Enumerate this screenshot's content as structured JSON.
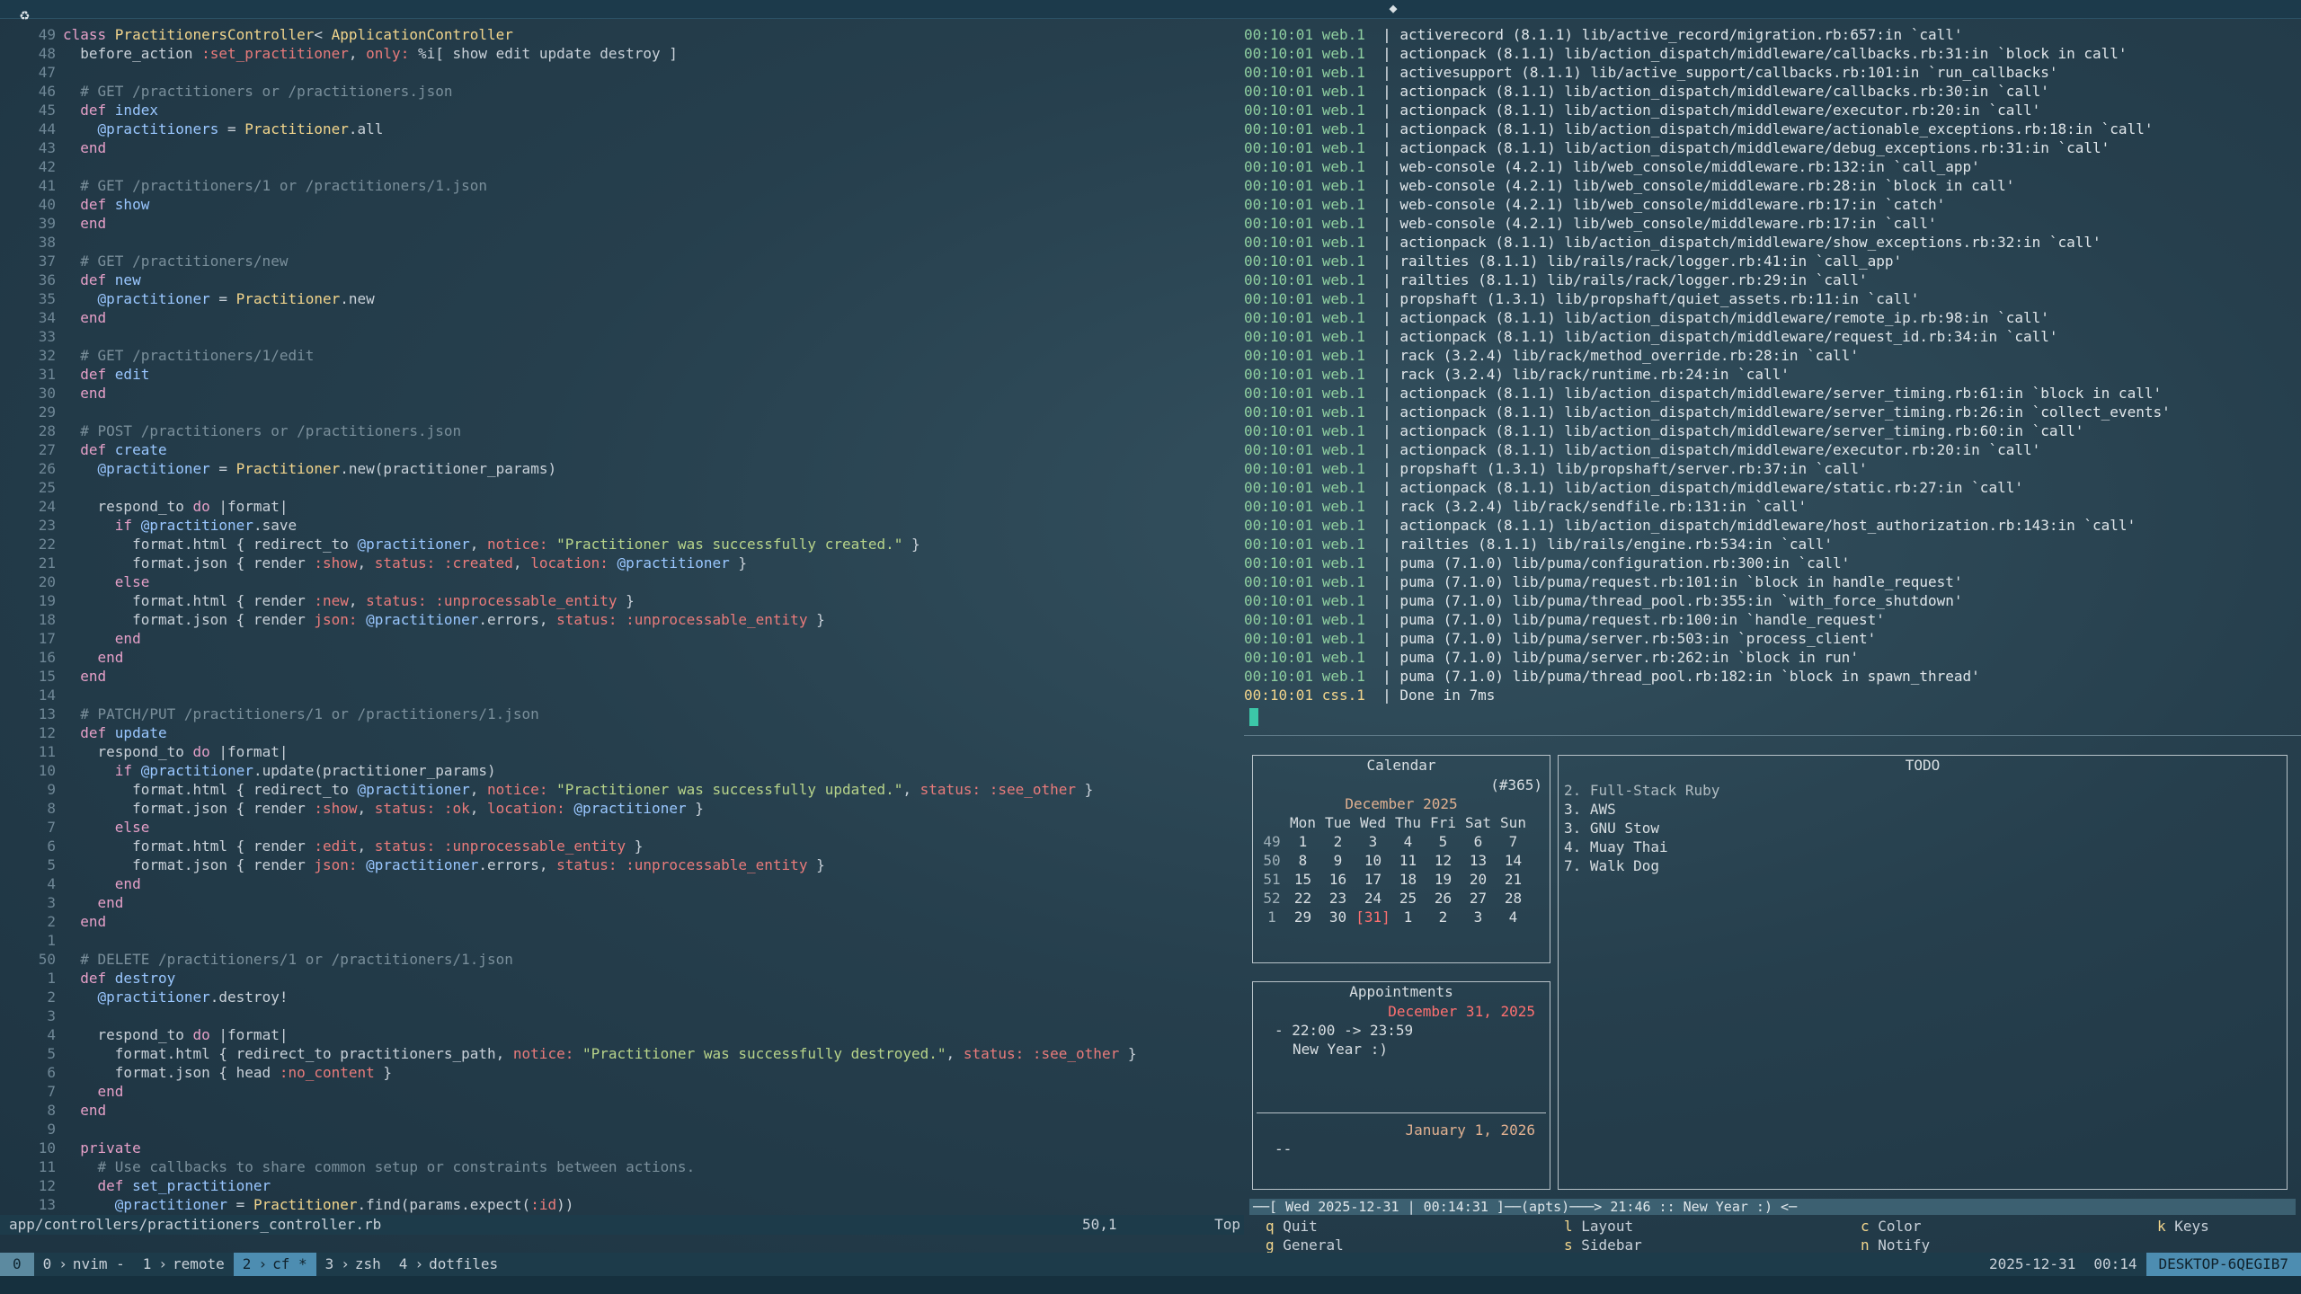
{
  "editor": {
    "status_file": "app/controllers/practitioners_controller.rb",
    "status_pos": "50,1",
    "status_scroll": "Top",
    "lines": [
      {
        "n": "49",
        "t": [
          [
            "kw",
            "class "
          ],
          [
            "cls",
            "PractitionersController"
          ],
          [
            "",
            "< "
          ],
          [
            "cls",
            "ApplicationController"
          ]
        ]
      },
      {
        "n": "48",
        "t": [
          [
            "",
            "  before_action "
          ],
          [
            "sym",
            ":set_practitioner"
          ],
          [
            "",
            ", "
          ],
          [
            "sym",
            "only: "
          ],
          [
            "",
            "%i[ show edit update destroy ]"
          ]
        ]
      },
      {
        "n": "47",
        "t": []
      },
      {
        "n": "46",
        "t": [
          [
            "cm",
            "  # GET /practitioners or /practitioners.json"
          ]
        ]
      },
      {
        "n": "45",
        "t": [
          [
            "kw",
            "  def "
          ],
          [
            "fn",
            "index"
          ]
        ]
      },
      {
        "n": "44",
        "t": [
          [
            "ivar",
            "    @practitioners"
          ],
          [
            "",
            " = "
          ],
          [
            "cls",
            "Practitioner"
          ],
          [
            "",
            ".all"
          ]
        ]
      },
      {
        "n": "43",
        "t": [
          [
            "kw",
            "  end"
          ]
        ]
      },
      {
        "n": "42",
        "t": []
      },
      {
        "n": "41",
        "t": [
          [
            "cm",
            "  # GET /practitioners/1 or /practitioners/1.json"
          ]
        ]
      },
      {
        "n": "40",
        "t": [
          [
            "kw",
            "  def "
          ],
          [
            "fn",
            "show"
          ]
        ]
      },
      {
        "n": "39",
        "t": [
          [
            "kw",
            "  end"
          ]
        ]
      },
      {
        "n": "38",
        "t": []
      },
      {
        "n": "37",
        "t": [
          [
            "cm",
            "  # GET /practitioners/new"
          ]
        ]
      },
      {
        "n": "36",
        "t": [
          [
            "kw",
            "  def "
          ],
          [
            "fn",
            "new"
          ]
        ]
      },
      {
        "n": "35",
        "t": [
          [
            "ivar",
            "    @practitioner"
          ],
          [
            "",
            " = "
          ],
          [
            "cls",
            "Practitioner"
          ],
          [
            "",
            ".new"
          ]
        ]
      },
      {
        "n": "34",
        "t": [
          [
            "kw",
            "  end"
          ]
        ]
      },
      {
        "n": "33",
        "t": []
      },
      {
        "n": "32",
        "t": [
          [
            "cm",
            "  # GET /practitioners/1/edit"
          ]
        ]
      },
      {
        "n": "31",
        "t": [
          [
            "kw",
            "  def "
          ],
          [
            "fn",
            "edit"
          ]
        ]
      },
      {
        "n": "30",
        "t": [
          [
            "kw",
            "  end"
          ]
        ]
      },
      {
        "n": "29",
        "t": []
      },
      {
        "n": "28",
        "t": [
          [
            "cm",
            "  # POST /practitioners or /practitioners.json"
          ]
        ]
      },
      {
        "n": "27",
        "t": [
          [
            "kw",
            "  def "
          ],
          [
            "fn",
            "create"
          ]
        ]
      },
      {
        "n": "26",
        "t": [
          [
            "ivar",
            "    @practitioner"
          ],
          [
            "",
            " = "
          ],
          [
            "cls",
            "Practitioner"
          ],
          [
            "",
            ".new(practitioner_params)"
          ]
        ]
      },
      {
        "n": "25",
        "t": []
      },
      {
        "n": "24",
        "t": [
          [
            "",
            "    respond_to "
          ],
          [
            "kw",
            "do"
          ],
          [
            "",
            " |format|"
          ]
        ]
      },
      {
        "n": "23",
        "t": [
          [
            "kw",
            "      if "
          ],
          [
            "ivar",
            "@practitioner"
          ],
          [
            "",
            ".save"
          ]
        ]
      },
      {
        "n": "22",
        "t": [
          [
            "",
            "        format.html { redirect_to "
          ],
          [
            "ivar",
            "@practitioner"
          ],
          [
            "",
            ", "
          ],
          [
            "sym",
            "notice: "
          ],
          [
            "str",
            "\"Practitioner was successfully created.\""
          ],
          [
            "",
            " }"
          ]
        ]
      },
      {
        "n": "21",
        "t": [
          [
            "",
            "        format.json { render "
          ],
          [
            "sym",
            ":show"
          ],
          [
            "",
            ", "
          ],
          [
            "sym",
            "status: "
          ],
          [
            "sym",
            ":created"
          ],
          [
            "",
            ", "
          ],
          [
            "sym",
            "location: "
          ],
          [
            "ivar",
            "@practitioner"
          ],
          [
            "",
            " }"
          ]
        ]
      },
      {
        "n": "20",
        "t": [
          [
            "kw",
            "      else"
          ]
        ]
      },
      {
        "n": "19",
        "t": [
          [
            "",
            "        format.html { render "
          ],
          [
            "sym",
            ":new"
          ],
          [
            "",
            ", "
          ],
          [
            "sym",
            "status: "
          ],
          [
            "sym",
            ":unprocessable_entity"
          ],
          [
            "",
            " }"
          ]
        ]
      },
      {
        "n": "18",
        "t": [
          [
            "",
            "        format.json { render "
          ],
          [
            "sym",
            "json: "
          ],
          [
            "ivar",
            "@practitioner"
          ],
          [
            "",
            ".errors, "
          ],
          [
            "sym",
            "status: "
          ],
          [
            "sym",
            ":unprocessable_entity"
          ],
          [
            "",
            " }"
          ]
        ]
      },
      {
        "n": "17",
        "t": [
          [
            "kw",
            "      end"
          ]
        ]
      },
      {
        "n": "16",
        "t": [
          [
            "kw",
            "    end"
          ]
        ]
      },
      {
        "n": "15",
        "t": [
          [
            "kw",
            "  end"
          ]
        ]
      },
      {
        "n": "14",
        "t": []
      },
      {
        "n": "13",
        "t": [
          [
            "cm",
            "  # PATCH/PUT /practitioners/1 or /practitioners/1.json"
          ]
        ]
      },
      {
        "n": "12",
        "t": [
          [
            "kw",
            "  def "
          ],
          [
            "fn",
            "update"
          ]
        ]
      },
      {
        "n": "11",
        "t": [
          [
            "",
            "    respond_to "
          ],
          [
            "kw",
            "do"
          ],
          [
            "",
            " |format|"
          ]
        ]
      },
      {
        "n": "10",
        "t": [
          [
            "kw",
            "      if "
          ],
          [
            "ivar",
            "@practitioner"
          ],
          [
            "",
            ".update(practitioner_params)"
          ]
        ]
      },
      {
        "n": "9",
        "t": [
          [
            "",
            "        format.html { redirect_to "
          ],
          [
            "ivar",
            "@practitioner"
          ],
          [
            "",
            ", "
          ],
          [
            "sym",
            "notice: "
          ],
          [
            "str",
            "\"Practitioner was successfully updated.\""
          ],
          [
            "",
            ", "
          ],
          [
            "sym",
            "status: "
          ],
          [
            "sym",
            ":see_other"
          ],
          [
            "",
            " }"
          ]
        ]
      },
      {
        "n": "8",
        "t": [
          [
            "",
            "        format.json { render "
          ],
          [
            "sym",
            ":show"
          ],
          [
            "",
            ", "
          ],
          [
            "sym",
            "status: "
          ],
          [
            "sym",
            ":ok"
          ],
          [
            "",
            ", "
          ],
          [
            "sym",
            "location: "
          ],
          [
            "ivar",
            "@practitioner"
          ],
          [
            "",
            " }"
          ]
        ]
      },
      {
        "n": "7",
        "t": [
          [
            "kw",
            "      else"
          ]
        ]
      },
      {
        "n": "6",
        "t": [
          [
            "",
            "        format.html { render "
          ],
          [
            "sym",
            ":edit"
          ],
          [
            "",
            ", "
          ],
          [
            "sym",
            "status: "
          ],
          [
            "sym",
            ":unprocessable_entity"
          ],
          [
            "",
            " }"
          ]
        ]
      },
      {
        "n": "5",
        "t": [
          [
            "",
            "        format.json { render "
          ],
          [
            "sym",
            "json: "
          ],
          [
            "ivar",
            "@practitioner"
          ],
          [
            "",
            ".errors, "
          ],
          [
            "sym",
            "status: "
          ],
          [
            "sym",
            ":unprocessable_entity"
          ],
          [
            "",
            " }"
          ]
        ]
      },
      {
        "n": "4",
        "t": [
          [
            "kw",
            "      end"
          ]
        ]
      },
      {
        "n": "3",
        "t": [
          [
            "kw",
            "    end"
          ]
        ]
      },
      {
        "n": "2",
        "t": [
          [
            "kw",
            "  end"
          ]
        ]
      },
      {
        "n": "1",
        "t": []
      },
      {
        "n": "50",
        "t": [
          [
            "cm",
            "  # DELETE /practitioners/1 or /practitioners/1.json"
          ]
        ]
      },
      {
        "n": "1",
        "t": [
          [
            "kw",
            "  def "
          ],
          [
            "fn",
            "destroy"
          ]
        ]
      },
      {
        "n": "2",
        "t": [
          [
            "ivar",
            "    @practitioner"
          ],
          [
            "",
            ".destroy!"
          ]
        ]
      },
      {
        "n": "3",
        "t": []
      },
      {
        "n": "4",
        "t": [
          [
            "",
            "    respond_to "
          ],
          [
            "kw",
            "do"
          ],
          [
            "",
            " |format|"
          ]
        ]
      },
      {
        "n": "5",
        "t": [
          [
            "",
            "      format.html { redirect_to practitioners_path, "
          ],
          [
            "sym",
            "notice: "
          ],
          [
            "str",
            "\"Practitioner was successfully destroyed.\""
          ],
          [
            "",
            ", "
          ],
          [
            "sym",
            "status: "
          ],
          [
            "sym",
            ":see_other"
          ],
          [
            "",
            " }"
          ]
        ]
      },
      {
        "n": "6",
        "t": [
          [
            "",
            "      format.json { head "
          ],
          [
            "sym",
            ":no_content"
          ],
          [
            "",
            " }"
          ]
        ]
      },
      {
        "n": "7",
        "t": [
          [
            "kw",
            "    end"
          ]
        ]
      },
      {
        "n": "8",
        "t": [
          [
            "kw",
            "  end"
          ]
        ]
      },
      {
        "n": "9",
        "t": []
      },
      {
        "n": "10",
        "t": [
          [
            "kw",
            "  private"
          ]
        ]
      },
      {
        "n": "11",
        "t": [
          [
            "cm",
            "    # Use callbacks to share common setup or constraints between actions."
          ]
        ]
      },
      {
        "n": "12",
        "t": [
          [
            "kw",
            "    def "
          ],
          [
            "fn",
            "set_practitioner"
          ]
        ]
      },
      {
        "n": "13",
        "t": [
          [
            "ivar",
            "      @practitioner"
          ],
          [
            "",
            " = "
          ],
          [
            "cls",
            "Practitioner"
          ],
          [
            "",
            ".find(params.expect("
          ],
          [
            "sym",
            ":id"
          ],
          [
            "",
            "))"
          ]
        ]
      }
    ]
  },
  "log": {
    "ts": "00:10:01",
    "src": "web.1",
    "lines": [
      "activerecord (8.1.1) lib/active_record/migration.rb:657:in `call'",
      "actionpack (8.1.1) lib/action_dispatch/middleware/callbacks.rb:31:in `block in call'",
      "activesupport (8.1.1) lib/active_support/callbacks.rb:101:in `run_callbacks'",
      "actionpack (8.1.1) lib/action_dispatch/middleware/callbacks.rb:30:in `call'",
      "actionpack (8.1.1) lib/action_dispatch/middleware/executor.rb:20:in `call'",
      "actionpack (8.1.1) lib/action_dispatch/middleware/actionable_exceptions.rb:18:in `call'",
      "actionpack (8.1.1) lib/action_dispatch/middleware/debug_exceptions.rb:31:in `call'",
      "web-console (4.2.1) lib/web_console/middleware.rb:132:in `call_app'",
      "web-console (4.2.1) lib/web_console/middleware.rb:28:in `block in call'",
      "web-console (4.2.1) lib/web_console/middleware.rb:17:in `catch'",
      "web-console (4.2.1) lib/web_console/middleware.rb:17:in `call'",
      "actionpack (8.1.1) lib/action_dispatch/middleware/show_exceptions.rb:32:in `call'",
      "railties (8.1.1) lib/rails/rack/logger.rb:41:in `call_app'",
      "railties (8.1.1) lib/rails/rack/logger.rb:29:in `call'",
      "propshaft (1.3.1) lib/propshaft/quiet_assets.rb:11:in `call'",
      "actionpack (8.1.1) lib/action_dispatch/middleware/remote_ip.rb:98:in `call'",
      "actionpack (8.1.1) lib/action_dispatch/middleware/request_id.rb:34:in `call'",
      "rack (3.2.4) lib/rack/method_override.rb:28:in `call'",
      "rack (3.2.4) lib/rack/runtime.rb:24:in `call'",
      "actionpack (8.1.1) lib/action_dispatch/middleware/server_timing.rb:61:in `block in call'",
      "actionpack (8.1.1) lib/action_dispatch/middleware/server_timing.rb:26:in `collect_events'",
      "actionpack (8.1.1) lib/action_dispatch/middleware/server_timing.rb:60:in `call'",
      "actionpack (8.1.1) lib/action_dispatch/middleware/executor.rb:20:in `call'",
      "propshaft (1.3.1) lib/propshaft/server.rb:37:in `call'",
      "actionpack (8.1.1) lib/action_dispatch/middleware/static.rb:27:in `call'",
      "rack (3.2.4) lib/rack/sendfile.rb:131:in `call'",
      "actionpack (8.1.1) lib/action_dispatch/middleware/host_authorization.rb:143:in `call'",
      "railties (8.1.1) lib/rails/engine.rb:534:in `call'",
      "puma (7.1.0) lib/puma/configuration.rb:300:in `call'",
      "puma (7.1.0) lib/puma/request.rb:101:in `block in handle_request'",
      "puma (7.1.0) lib/puma/thread_pool.rb:355:in `with_force_shutdown'",
      "puma (7.1.0) lib/puma/request.rb:100:in `handle_request'",
      "puma (7.1.0) lib/puma/server.rb:503:in `process_client'",
      "puma (7.1.0) lib/puma/server.rb:262:in `block in run'",
      "puma (7.1.0) lib/puma/thread_pool.rb:182:in `block in spawn_thread'"
    ],
    "css_line": {
      "ts": "00:10:01",
      "src": "css.1",
      "text": "Done in 7ms"
    }
  },
  "calendar": {
    "title": "Calendar",
    "counter": "(#365)",
    "month": "December 2025",
    "header": [
      "Mon",
      "Tue",
      "Wed",
      "Thu",
      "Fri",
      "Sat",
      "Sun"
    ],
    "rows": [
      {
        "wk": "49",
        "d": [
          "1",
          "2",
          "3",
          "4",
          "5",
          "6",
          "7"
        ]
      },
      {
        "wk": "50",
        "d": [
          "8",
          "9",
          "10",
          "11",
          "12",
          "13",
          "14"
        ]
      },
      {
        "wk": "51",
        "d": [
          "15",
          "16",
          "17",
          "18",
          "19",
          "20",
          "21"
        ]
      },
      {
        "wk": "52",
        "d": [
          "22",
          "23",
          "24",
          "25",
          "26",
          "27",
          "28"
        ]
      },
      {
        "wk": "1",
        "d": [
          "29",
          "30",
          "[31]",
          "1",
          "2",
          "3",
          "4"
        ]
      }
    ]
  },
  "todo": {
    "title": "TODO",
    "items": [
      "2. Full-Stack Ruby",
      "3. AWS",
      "3. GNU Stow",
      "4. Muay Thai",
      "7. Walk Dog"
    ]
  },
  "appointments": {
    "title": "Appointments",
    "date1": "December 31, 2025",
    "event_time": "- 22:00 -> 23:59",
    "event_name": "New Year :)",
    "date2": "January  1, 2026",
    "date2_event": "--"
  },
  "calcurse_bar": "──[ Wed 2025-12-31 | 00:14:31 ]──(apts)───> 21:46 :: New Year :) <─",
  "keys": [
    {
      "k": "q",
      "label": "Quit"
    },
    {
      "k": "g",
      "label": "General"
    },
    {
      "k": "l",
      "label": "Layout"
    },
    {
      "k": "s",
      "label": "Sidebar"
    },
    {
      "k": "c",
      "label": "Color"
    },
    {
      "k": "n",
      "label": "Notify"
    },
    {
      "k": "k",
      "label": "Keys"
    }
  ],
  "tmux": {
    "session": "0",
    "windows": [
      {
        "idx": "0",
        "name": "nvim -",
        "active": false
      },
      {
        "idx": "1",
        "name": "remote",
        "active": false
      },
      {
        "idx": "2",
        "name": "cf *",
        "active": true
      },
      {
        "idx": "3",
        "name": "zsh",
        "active": false
      },
      {
        "idx": "4",
        "name": "dotfiles",
        "active": false
      }
    ],
    "date": "2025-12-31",
    "time": "00:14",
    "host": "DESKTOP-6QEGIB7"
  }
}
